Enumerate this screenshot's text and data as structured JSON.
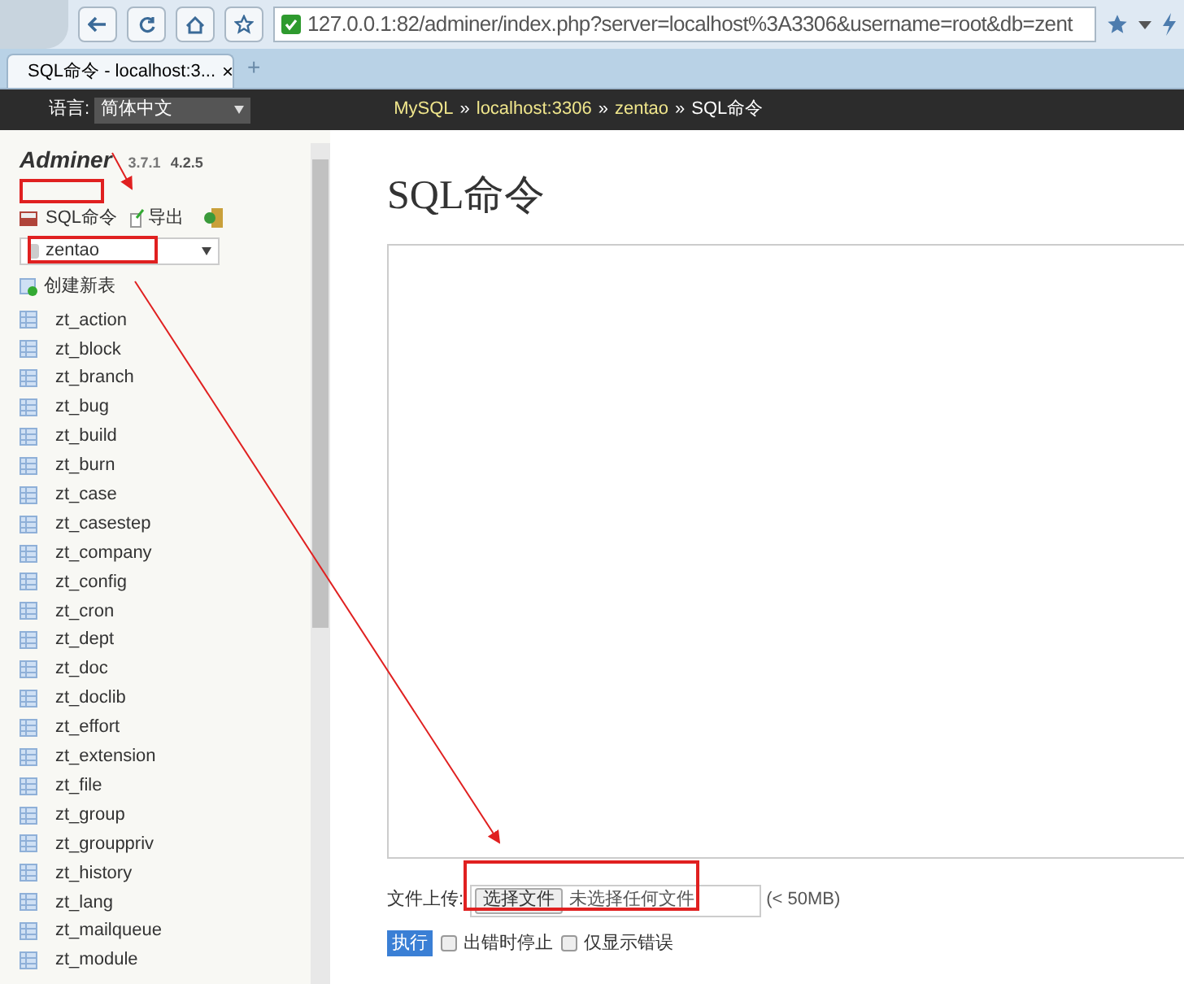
{
  "browser": {
    "address": "127.0.0.1:82/adminer/index.php?server=localhost%3A3306&username=root&db=zent",
    "tab_title": "SQL命令 - localhost:3...",
    "tab_close": "×",
    "new_tab": "+"
  },
  "header": {
    "language_label": "语言:",
    "language": "简体中文",
    "breadcrumbs": [
      {
        "label": "MySQL",
        "link": true
      },
      {
        "label": "localhost:3306",
        "link": true
      },
      {
        "label": "zentao",
        "link": true
      },
      {
        "label": "SQL命令",
        "link": false
      }
    ],
    "separator": "»"
  },
  "sidebar": {
    "brand": "Adminer",
    "version": "3.7.1",
    "new_version": "4.2.5",
    "links": [
      "SQL命令",
      "导出"
    ],
    "database": "zentao",
    "create_table": "创建新表",
    "tables": [
      "zt_action",
      "zt_block",
      "zt_branch",
      "zt_bug",
      "zt_build",
      "zt_burn",
      "zt_case",
      "zt_casestep",
      "zt_company",
      "zt_config",
      "zt_cron",
      "zt_dept",
      "zt_doc",
      "zt_doclib",
      "zt_effort",
      "zt_extension",
      "zt_file",
      "zt_group",
      "zt_grouppriv",
      "zt_history",
      "zt_lang",
      "zt_mailqueue",
      "zt_module"
    ]
  },
  "main": {
    "title": "SQL命令",
    "file_label": "文件上传:",
    "file_button": "选择文件",
    "file_status": "未选择任何文件",
    "file_limit": "(< 50MB)",
    "execute": "执行",
    "options": [
      {
        "label": "出错时停止",
        "checked": false
      },
      {
        "label": "仅显示错误",
        "checked": false
      }
    ]
  }
}
